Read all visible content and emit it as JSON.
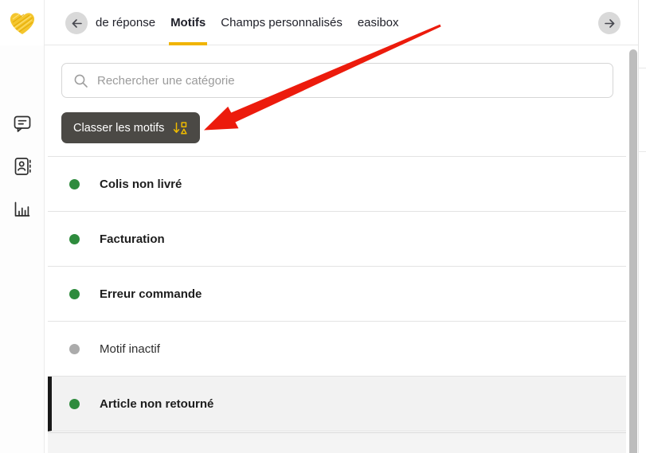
{
  "header": {
    "tabs": [
      {
        "label": "de réponse",
        "active": false
      },
      {
        "label": "Motifs",
        "active": true
      },
      {
        "label": "Champs personnalisés",
        "active": false
      },
      {
        "label": "easibox",
        "active": false
      }
    ]
  },
  "search": {
    "placeholder": "Rechercher une catégorie",
    "value": ""
  },
  "toolbar": {
    "sort_button_label": "Classer les motifs"
  },
  "categories": {
    "items": [
      {
        "label": "Colis non livré",
        "status": "active",
        "selected": "false"
      },
      {
        "label": "Facturation",
        "status": "active",
        "selected": "false"
      },
      {
        "label": "Erreur commande",
        "status": "active",
        "selected": "false"
      },
      {
        "label": "Motif inactif",
        "status": "inactive",
        "selected": "false"
      },
      {
        "label": "Article non retourné",
        "status": "active",
        "selected": "true"
      }
    ]
  },
  "annotation": {
    "shape": "red-arrow",
    "target_label": "Classer les motifs"
  },
  "colors": {
    "accent_yellow": "#F0B400",
    "active_green": "#2E8B3D",
    "inactive_gray": "#ABABAB",
    "button_dark": "#4B4945",
    "annotation_red": "#EC1B0C"
  }
}
